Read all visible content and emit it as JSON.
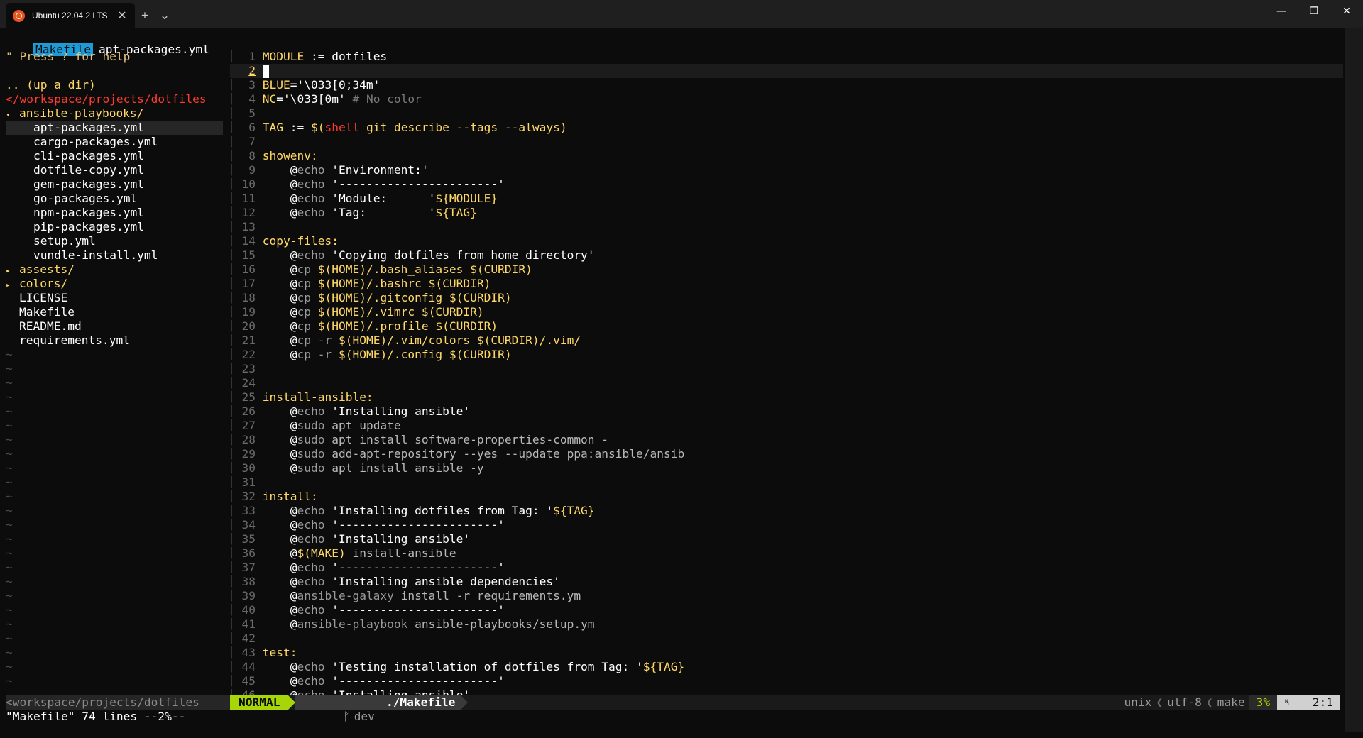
{
  "window": {
    "tab_title": "Ubuntu 22.04.2 LTS",
    "tab_close": "✕",
    "new_tab": "+",
    "tab_menu": "⌄",
    "minimize": "—",
    "maximize": "❐",
    "close": "✕"
  },
  "tabline": {
    "active": "Makefile",
    "inactive": "apt-packages.yml"
  },
  "tree": {
    "help": "\" Press ? for help",
    "up": ".. (up a dir)",
    "root": "</workspace/projects/dotfiles",
    "items": [
      {
        "arrow": "▾",
        "label": "ansible-playbooks/",
        "kind": "dir",
        "indent": 0
      },
      {
        "arrow": "",
        "label": "apt-packages.yml",
        "kind": "file",
        "indent": 2,
        "current": true
      },
      {
        "arrow": "",
        "label": "cargo-packages.yml",
        "kind": "file",
        "indent": 2
      },
      {
        "arrow": "",
        "label": "cli-packages.yml",
        "kind": "file",
        "indent": 2
      },
      {
        "arrow": "",
        "label": "dotfile-copy.yml",
        "kind": "file",
        "indent": 2
      },
      {
        "arrow": "",
        "label": "gem-packages.yml",
        "kind": "file",
        "indent": 2
      },
      {
        "arrow": "",
        "label": "go-packages.yml",
        "kind": "file",
        "indent": 2
      },
      {
        "arrow": "",
        "label": "npm-packages.yml",
        "kind": "file",
        "indent": 2
      },
      {
        "arrow": "",
        "label": "pip-packages.yml",
        "kind": "file",
        "indent": 2
      },
      {
        "arrow": "",
        "label": "setup.yml",
        "kind": "file",
        "indent": 2
      },
      {
        "arrow": "",
        "label": "vundle-install.yml",
        "kind": "file",
        "indent": 2
      },
      {
        "arrow": "▸",
        "label": "assests/",
        "kind": "dir",
        "indent": 0
      },
      {
        "arrow": "▸",
        "label": "colors/",
        "kind": "dir",
        "indent": 0
      },
      {
        "arrow": "",
        "label": "LICENSE",
        "kind": "file",
        "indent": 1
      },
      {
        "arrow": "",
        "label": "Makefile",
        "kind": "file",
        "indent": 1
      },
      {
        "arrow": "",
        "label": "README.md",
        "kind": "file",
        "indent": 1
      },
      {
        "arrow": "",
        "label": "requirements.yml",
        "kind": "file",
        "indent": 1
      }
    ],
    "tilde": "~"
  },
  "code_lines": [
    {
      "n": "1",
      "tokens": [
        [
          "k-var",
          "MODULE"
        ],
        [
          "k-txt",
          " := dotfiles"
        ]
      ]
    },
    {
      "n": "2",
      "tokens": [],
      "current": true
    },
    {
      "n": "3",
      "tokens": [
        [
          "k-var",
          "BLUE"
        ],
        [
          "k-txt",
          "='\\033[0;34m'"
        ]
      ]
    },
    {
      "n": "4",
      "tokens": [
        [
          "k-var",
          "NC"
        ],
        [
          "k-txt",
          "='\\033[0m' "
        ],
        [
          "k-cmt",
          "# No color"
        ]
      ]
    },
    {
      "n": "5",
      "tokens": []
    },
    {
      "n": "6",
      "tokens": [
        [
          "k-var",
          "TAG"
        ],
        [
          "k-txt",
          " := "
        ],
        [
          "k-ref",
          "$("
        ],
        [
          "k-fn",
          "shell"
        ],
        [
          "k-ref",
          " git describe --tags --always)"
        ]
      ]
    },
    {
      "n": "7",
      "tokens": []
    },
    {
      "n": "8",
      "tokens": [
        [
          "k-tgt",
          "showenv:"
        ]
      ]
    },
    {
      "n": "9",
      "tokens": [
        [
          "k-txt",
          "    "
        ],
        [
          "k-at",
          "@"
        ],
        [
          "k-cmd",
          "echo"
        ],
        [
          "k-str",
          " 'Environment:'"
        ]
      ]
    },
    {
      "n": "10",
      "tokens": [
        [
          "k-txt",
          "    "
        ],
        [
          "k-at",
          "@"
        ],
        [
          "k-cmd",
          "echo"
        ],
        [
          "k-str",
          " '-----------------------'"
        ]
      ]
    },
    {
      "n": "11",
      "tokens": [
        [
          "k-txt",
          "    "
        ],
        [
          "k-at",
          "@"
        ],
        [
          "k-cmd",
          "echo"
        ],
        [
          "k-str",
          " 'Module:      '"
        ],
        [
          "k-ref",
          "${MODULE}"
        ]
      ]
    },
    {
      "n": "12",
      "tokens": [
        [
          "k-txt",
          "    "
        ],
        [
          "k-at",
          "@"
        ],
        [
          "k-cmd",
          "echo"
        ],
        [
          "k-str",
          " 'Tag:         '"
        ],
        [
          "k-ref",
          "${TAG}"
        ]
      ]
    },
    {
      "n": "13",
      "tokens": []
    },
    {
      "n": "14",
      "tokens": [
        [
          "k-tgt",
          "copy-files:"
        ]
      ]
    },
    {
      "n": "15",
      "tokens": [
        [
          "k-txt",
          "    "
        ],
        [
          "k-at",
          "@"
        ],
        [
          "k-cmd",
          "echo"
        ],
        [
          "k-str",
          " 'Copying dotfiles from home directory'"
        ]
      ]
    },
    {
      "n": "16",
      "tokens": [
        [
          "k-txt",
          "    "
        ],
        [
          "k-at",
          "@"
        ],
        [
          "k-cmd",
          "cp"
        ],
        [
          "k-ref",
          " $(HOME)/.bash_aliases $(CURDIR)"
        ]
      ]
    },
    {
      "n": "17",
      "tokens": [
        [
          "k-txt",
          "    "
        ],
        [
          "k-at",
          "@"
        ],
        [
          "k-cmd",
          "cp"
        ],
        [
          "k-ref",
          " $(HOME)/.bashrc $(CURDIR)"
        ]
      ]
    },
    {
      "n": "18",
      "tokens": [
        [
          "k-txt",
          "    "
        ],
        [
          "k-at",
          "@"
        ],
        [
          "k-cmd",
          "cp"
        ],
        [
          "k-ref",
          " $(HOME)/.gitconfig $(CURDIR)"
        ]
      ]
    },
    {
      "n": "19",
      "tokens": [
        [
          "k-txt",
          "    "
        ],
        [
          "k-at",
          "@"
        ],
        [
          "k-cmd",
          "cp"
        ],
        [
          "k-ref",
          " $(HOME)/.vimrc $(CURDIR)"
        ]
      ]
    },
    {
      "n": "20",
      "tokens": [
        [
          "k-txt",
          "    "
        ],
        [
          "k-at",
          "@"
        ],
        [
          "k-cmd",
          "cp"
        ],
        [
          "k-ref",
          " $(HOME)/.profile $(CURDIR)"
        ]
      ]
    },
    {
      "n": "21",
      "tokens": [
        [
          "k-txt",
          "    "
        ],
        [
          "k-at",
          "@"
        ],
        [
          "k-cmd",
          "cp -r"
        ],
        [
          "k-ref",
          " $(HOME)/.vim/colors $(CURDIR)/.vim/"
        ]
      ]
    },
    {
      "n": "22",
      "tokens": [
        [
          "k-txt",
          "    "
        ],
        [
          "k-at",
          "@"
        ],
        [
          "k-cmd",
          "cp -r"
        ],
        [
          "k-ref",
          " $(HOME)/.config $(CURDIR)"
        ]
      ]
    },
    {
      "n": "23",
      "tokens": []
    },
    {
      "n": "24",
      "tokens": []
    },
    {
      "n": "25",
      "tokens": [
        [
          "k-tgt",
          "install-ansible:"
        ]
      ]
    },
    {
      "n": "26",
      "tokens": [
        [
          "k-txt",
          "    "
        ],
        [
          "k-at",
          "@"
        ],
        [
          "k-cmd",
          "echo"
        ],
        [
          "k-str",
          " 'Installing ansible'"
        ]
      ]
    },
    {
      "n": "27",
      "tokens": [
        [
          "k-txt",
          "    "
        ],
        [
          "k-at",
          "@"
        ],
        [
          "k-cmd",
          "sudo"
        ],
        [
          "k-arg",
          " apt update"
        ]
      ]
    },
    {
      "n": "28",
      "tokens": [
        [
          "k-txt",
          "    "
        ],
        [
          "k-at",
          "@"
        ],
        [
          "k-cmd",
          "sudo"
        ],
        [
          "k-arg",
          " apt install software-properties-common -"
        ]
      ]
    },
    {
      "n": "29",
      "tokens": [
        [
          "k-txt",
          "    "
        ],
        [
          "k-at",
          "@"
        ],
        [
          "k-cmd",
          "sudo"
        ],
        [
          "k-arg",
          " add-apt-repository --yes --update ppa:ansible/ansib"
        ]
      ]
    },
    {
      "n": "30",
      "tokens": [
        [
          "k-txt",
          "    "
        ],
        [
          "k-at",
          "@"
        ],
        [
          "k-cmd",
          "sudo"
        ],
        [
          "k-arg",
          " apt install ansible -y"
        ]
      ]
    },
    {
      "n": "31",
      "tokens": []
    },
    {
      "n": "32",
      "tokens": [
        [
          "k-tgt",
          "install:"
        ]
      ]
    },
    {
      "n": "33",
      "tokens": [
        [
          "k-txt",
          "    "
        ],
        [
          "k-at",
          "@"
        ],
        [
          "k-cmd",
          "echo"
        ],
        [
          "k-str",
          " 'Installing dotfiles from Tag: '"
        ],
        [
          "k-ref",
          "${TAG}"
        ]
      ]
    },
    {
      "n": "34",
      "tokens": [
        [
          "k-txt",
          "    "
        ],
        [
          "k-at",
          "@"
        ],
        [
          "k-cmd",
          "echo"
        ],
        [
          "k-str",
          " '-----------------------'"
        ]
      ]
    },
    {
      "n": "35",
      "tokens": [
        [
          "k-txt",
          "    "
        ],
        [
          "k-at",
          "@"
        ],
        [
          "k-cmd",
          "echo"
        ],
        [
          "k-str",
          " 'Installing ansible'"
        ]
      ]
    },
    {
      "n": "36",
      "tokens": [
        [
          "k-txt",
          "    "
        ],
        [
          "k-at",
          "@"
        ],
        [
          "k-ref",
          "$(MAKE)"
        ],
        [
          "k-arg",
          " install-ansible"
        ]
      ]
    },
    {
      "n": "37",
      "tokens": [
        [
          "k-txt",
          "    "
        ],
        [
          "k-at",
          "@"
        ],
        [
          "k-cmd",
          "echo"
        ],
        [
          "k-str",
          " '-----------------------'"
        ]
      ]
    },
    {
      "n": "38",
      "tokens": [
        [
          "k-txt",
          "    "
        ],
        [
          "k-at",
          "@"
        ],
        [
          "k-cmd",
          "echo"
        ],
        [
          "k-str",
          " 'Installing ansible dependencies'"
        ]
      ]
    },
    {
      "n": "39",
      "tokens": [
        [
          "k-txt",
          "    "
        ],
        [
          "k-at",
          "@"
        ],
        [
          "k-cmd",
          "ansible-galaxy"
        ],
        [
          "k-arg",
          " install -r requirements.ym"
        ]
      ]
    },
    {
      "n": "40",
      "tokens": [
        [
          "k-txt",
          "    "
        ],
        [
          "k-at",
          "@"
        ],
        [
          "k-cmd",
          "echo"
        ],
        [
          "k-str",
          " '-----------------------'"
        ]
      ]
    },
    {
      "n": "41",
      "tokens": [
        [
          "k-txt",
          "    "
        ],
        [
          "k-at",
          "@"
        ],
        [
          "k-cmd",
          "ansible-playbook"
        ],
        [
          "k-arg",
          " ansible-playbooks/setup.ym"
        ]
      ]
    },
    {
      "n": "42",
      "tokens": []
    },
    {
      "n": "43",
      "tokens": [
        [
          "k-tgt",
          "test:"
        ]
      ]
    },
    {
      "n": "44",
      "tokens": [
        [
          "k-txt",
          "    "
        ],
        [
          "k-at",
          "@"
        ],
        [
          "k-cmd",
          "echo"
        ],
        [
          "k-str",
          " 'Testing installation of dotfiles from Tag: '"
        ],
        [
          "k-ref",
          "${TAG}"
        ]
      ]
    },
    {
      "n": "45",
      "tokens": [
        [
          "k-txt",
          "    "
        ],
        [
          "k-at",
          "@"
        ],
        [
          "k-cmd",
          "echo"
        ],
        [
          "k-str",
          " '-----------------------'"
        ]
      ]
    },
    {
      "n": "46",
      "tokens": [
        [
          "k-txt",
          "    "
        ],
        [
          "k-at",
          "@"
        ],
        [
          "k-cmd",
          "echo"
        ],
        [
          "k-str",
          " 'Installing ansible'"
        ]
      ]
    }
  ],
  "statusline": {
    "tree_path": "<workspace/projects/dotfiles",
    "mode": "NORMAL",
    "branch_icon": "ᚠ",
    "branch": "dev",
    "file": "./Makefile",
    "format": "unix",
    "encoding": "utf-8",
    "filetype": "make",
    "percent": "3%",
    "line_icon": "␤",
    "position": "2:1"
  },
  "cmdline": "\"Makefile\" 74 lines --2%--",
  "colors": {
    "background": "#0c0c0c",
    "mode_green": "#a6d608",
    "tab_active": "#1e9ad6",
    "tree_root": "#ff3b30",
    "directory": "#ffd866"
  }
}
